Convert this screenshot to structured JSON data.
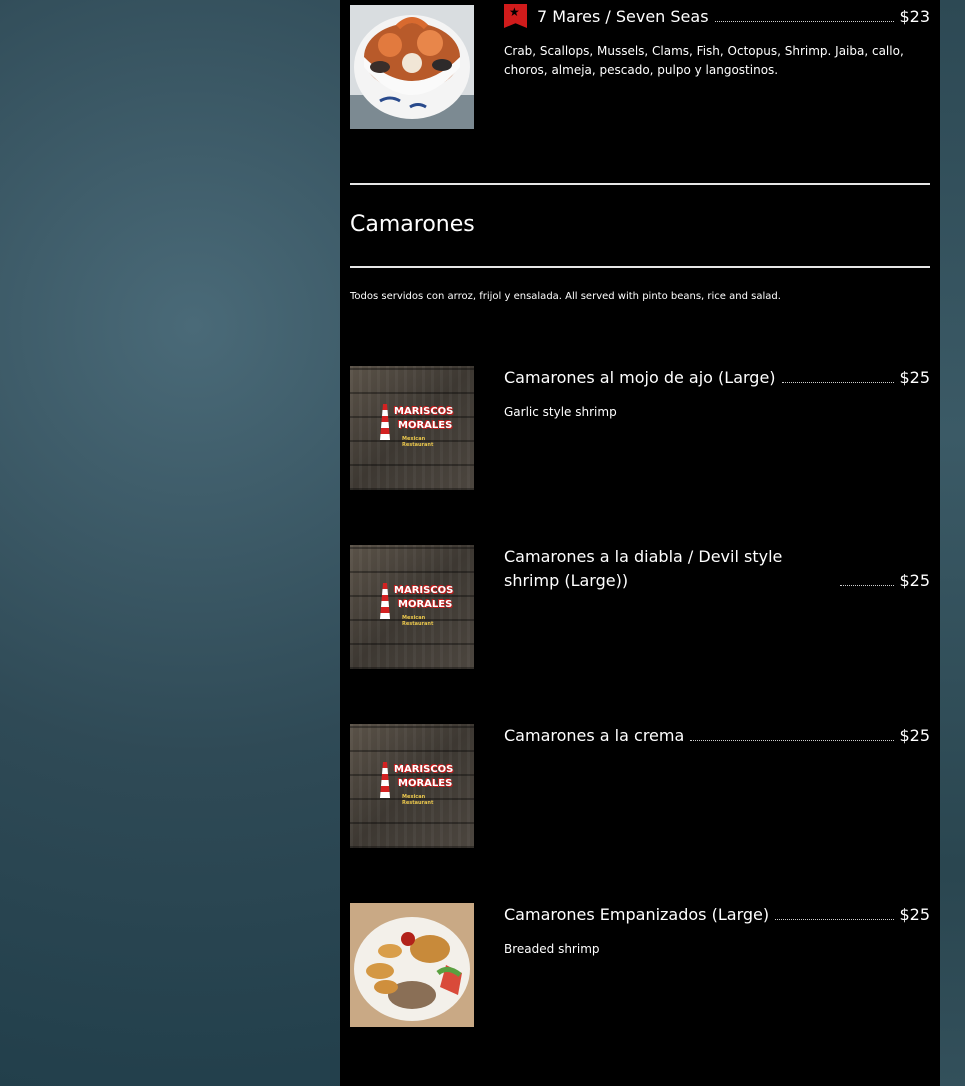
{
  "items_top": [
    {
      "name": "7 Mares / Seven Seas",
      "price": "$23",
      "description": "Crab, Scallops, Mussels, Clams, Fish, Octopus, Shrimp. Jaiba, callo, choros, almeja, pescado, pulpo y langostinos.",
      "featured_icon": "star-icon"
    }
  ],
  "section": {
    "title": "Camarones",
    "note": "Todos servidos con arroz, frijol y ensalada. All served with pinto beans, rice and salad."
  },
  "items": [
    {
      "name": "Camarones al mojo de ajo (Large)",
      "price": "$25",
      "description": "Garlic style shrimp"
    },
    {
      "name": "Camarones a la diabla / Devil style shrimp (Large))",
      "price": "$25",
      "description": ""
    },
    {
      "name": "Camarones a la crema",
      "price": "$25",
      "description": ""
    },
    {
      "name": "Camarones Empanizados (Large)",
      "price": "$25",
      "description": "Breaded shrimp"
    }
  ],
  "logo": {
    "line1": "MARISCOS",
    "line2": "MORALES",
    "line3": "Mexican Restaurant"
  },
  "colors": {
    "panel": "#000000",
    "accent_red": "#d01b1b",
    "text": "#ffffff"
  }
}
